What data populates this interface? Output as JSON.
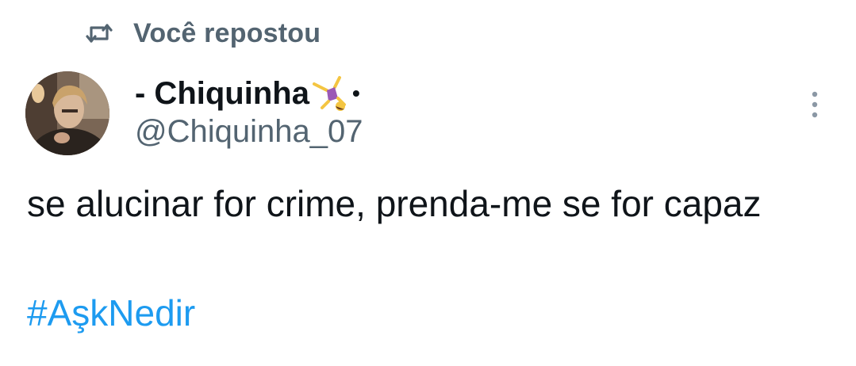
{
  "repost": {
    "icon": "repost-icon",
    "label": "Você repostou"
  },
  "author": {
    "display_name": "- Chiquinha",
    "name_emoji": "person-cartwheeling-emoji",
    "separator": "•",
    "handle": "@Chiquinha_07",
    "avatar": "profile-photo"
  },
  "menu": {
    "icon": "more-vertical-icon"
  },
  "tweet": {
    "text": "se alucinar for crime, prenda-me se for capaz",
    "hashtag": "#AşkNedir"
  },
  "colors": {
    "text": "#0f1419",
    "secondary": "#536471",
    "link": "#1d9bf0",
    "background": "#ffffff"
  }
}
